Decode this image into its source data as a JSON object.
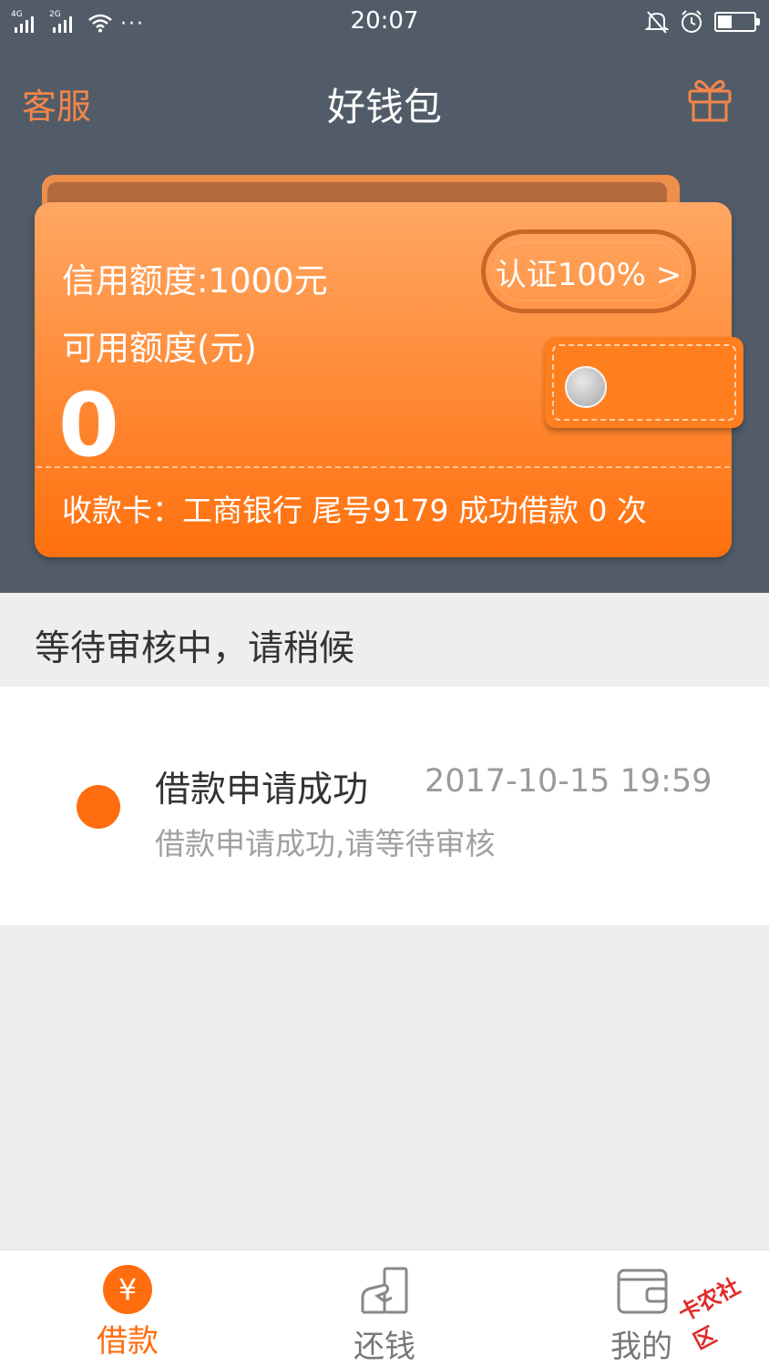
{
  "status_bar": {
    "net1": "4G",
    "net2": "2G",
    "time": "20:07",
    "battery_level": 0.4
  },
  "header": {
    "left_label": "客服",
    "title": "好钱包",
    "right_icon": "gift-icon"
  },
  "wallet": {
    "credit_limit": "信用额度:1000元",
    "available_label": "可用额度(元)",
    "available_value": "0",
    "cert_button": "认证100% >",
    "card_info": "收款卡：工商银行 尾号9179 成功借款 0 次"
  },
  "status": {
    "text": "等待审核中，请稍候"
  },
  "timeline": {
    "title": "借款申请成功",
    "time": "2017-10-15 19:59",
    "desc": "借款申请成功,请等待审核"
  },
  "tabs": [
    {
      "label": "借款",
      "icon": "yen-icon",
      "active": true
    },
    {
      "label": "还钱",
      "icon": "repay-icon",
      "active": false
    },
    {
      "label": "我的",
      "icon": "wallet-icon",
      "active": false
    }
  ],
  "watermark": "卡农社区",
  "colors": {
    "header_bg": "#525c68",
    "accent": "#ff6d0f",
    "nav_left": "#f2864a"
  }
}
